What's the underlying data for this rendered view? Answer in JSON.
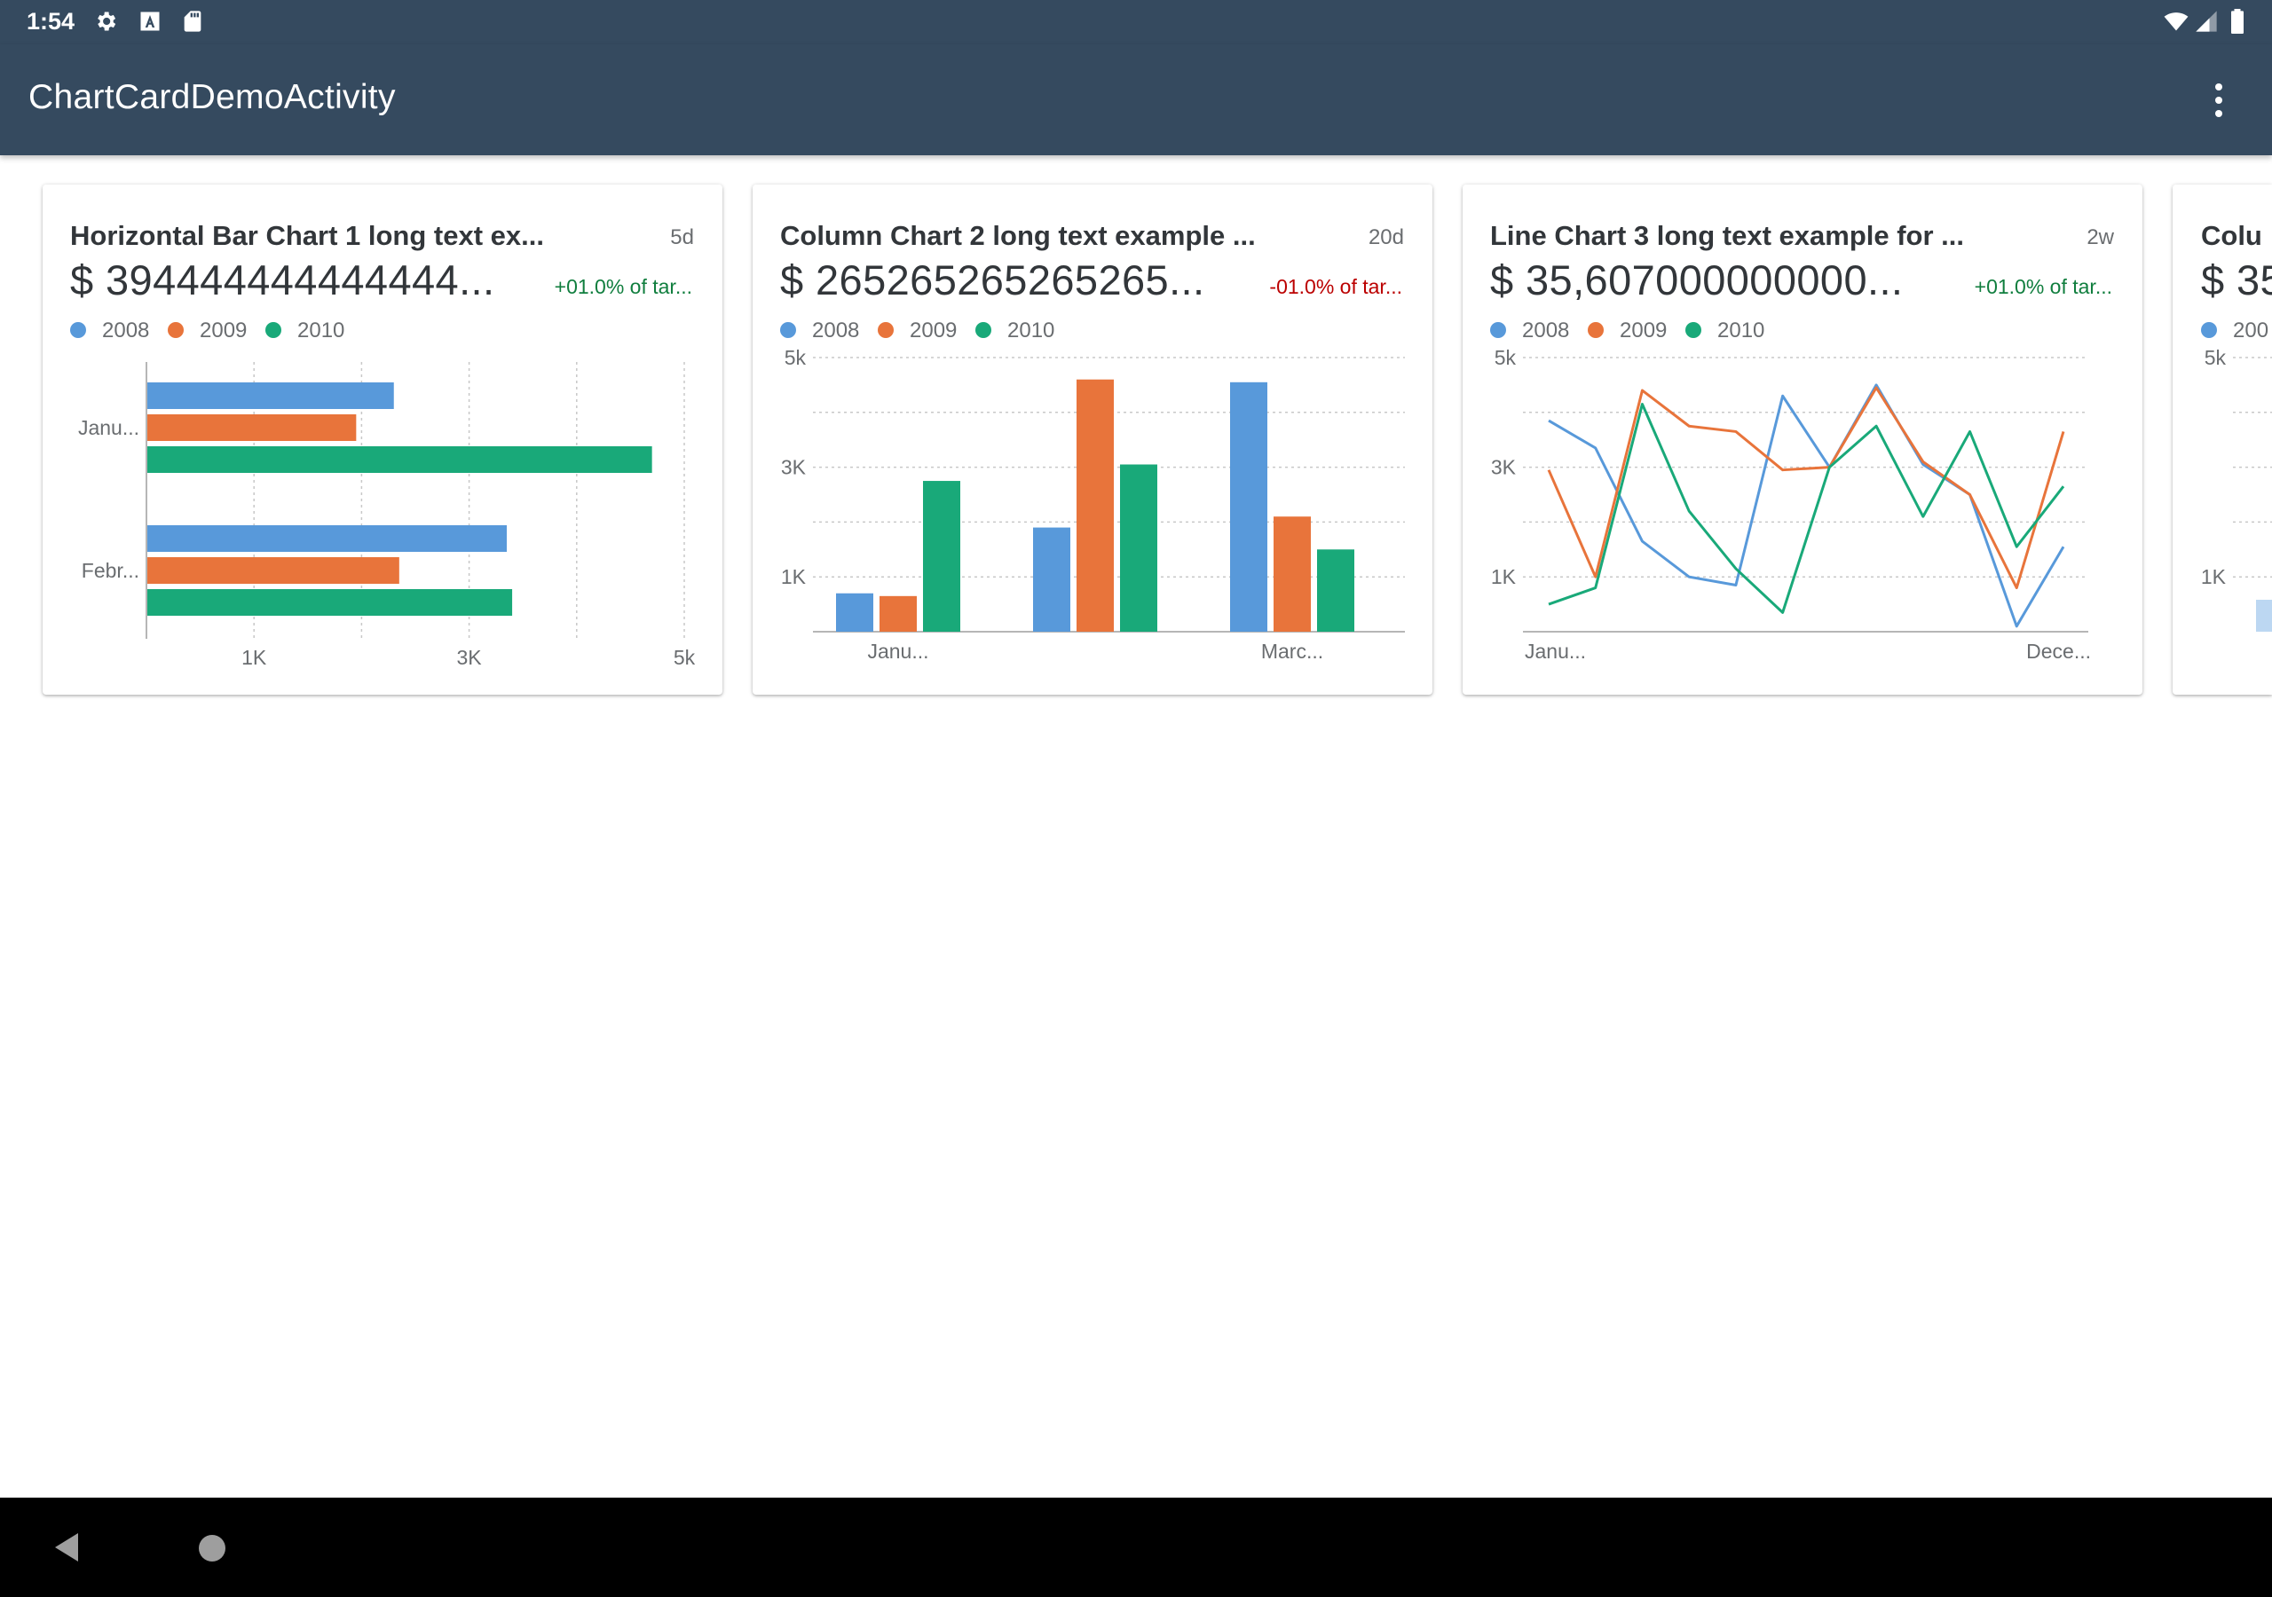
{
  "status_bar": {
    "time": "1:54",
    "icons": [
      "gear-icon",
      "text-a-icon",
      "sd-card-icon",
      "wifi-icon",
      "signal-icon",
      "battery-icon"
    ]
  },
  "app_bar": {
    "title": "ChartCardDemoActivity",
    "overflow_icon": "more-vert-icon"
  },
  "colors": {
    "bar": "#354a5f",
    "series_2008": "#5899da",
    "series_2009": "#e8743b",
    "series_2010": "#19a979",
    "positive": "#107e3e",
    "negative": "#bb0000"
  },
  "legend": [
    "2008",
    "2009",
    "2010"
  ],
  "cards": [
    {
      "title": "Horizontal Bar Chart 1 long text ex...",
      "age": "5d",
      "kpi": "$ 394444444444444...",
      "trend": "+01.0% of tar...",
      "trend_direction": "positive"
    },
    {
      "title": "Column Chart 2 long text example ...",
      "age": "20d",
      "kpi": "$ 265265265265265...",
      "trend": "-01.0% of tar...",
      "trend_direction": "negative"
    },
    {
      "title": "Line Chart 3 long text example for ...",
      "age": "2w",
      "kpi": "$ 35,607000000000...",
      "trend": "+01.0% of tar...",
      "trend_direction": "positive"
    },
    {
      "title": "Colu",
      "age": "",
      "kpi": "$ 35",
      "trend": "",
      "legend_partial": "200"
    }
  ],
  "chart_data": [
    {
      "type": "bar",
      "orientation": "horizontal",
      "categories": [
        "Janu...",
        "Febr..."
      ],
      "series": [
        {
          "name": "2008",
          "values": [
            2300,
            3350
          ]
        },
        {
          "name": "2009",
          "values": [
            1950,
            2350
          ]
        },
        {
          "name": "2010",
          "values": [
            4700,
            3400
          ]
        }
      ],
      "xlim": [
        0,
        5000
      ],
      "x_tick_labels": [
        "1K",
        "3K",
        "5k"
      ],
      "x_tick_values": [
        1000,
        3000,
        5000
      ],
      "grid": true
    },
    {
      "type": "bar",
      "categories": [
        "Janu...",
        "",
        "Marc..."
      ],
      "series": [
        {
          "name": "2008",
          "values": [
            700,
            1900,
            4550
          ]
        },
        {
          "name": "2009",
          "values": [
            650,
            4600,
            2100
          ]
        },
        {
          "name": "2010",
          "values": [
            2750,
            3050,
            1500
          ]
        }
      ],
      "ylim": [
        0,
        5000
      ],
      "y_tick_labels": [
        "1K",
        "3K",
        "5k"
      ],
      "y_tick_values": [
        1000,
        3000,
        5000
      ],
      "grid": true
    },
    {
      "type": "line",
      "categories": [
        "Janu...",
        "",
        "",
        "",
        "",
        "",
        "",
        "",
        "",
        "",
        "",
        "Dece..."
      ],
      "series": [
        {
          "name": "2008",
          "values": [
            3850,
            3350,
            1650,
            1000,
            850,
            4300,
            3000,
            4500,
            3050,
            2500,
            100,
            1550
          ]
        },
        {
          "name": "2009",
          "values": [
            2950,
            1000,
            4400,
            3750,
            3650,
            2950,
            3000,
            4450,
            3100,
            2500,
            800,
            3650
          ]
        },
        {
          "name": "2010",
          "values": [
            500,
            800,
            4150,
            2200,
            1150,
            350,
            3000,
            3750,
            2100,
            3650,
            1550,
            2650
          ]
        }
      ],
      "ylim": [
        0,
        5000
      ],
      "y_tick_labels": [
        "1K",
        "3K",
        "5k"
      ],
      "y_tick_values": [
        1000,
        3000,
        5000
      ],
      "grid": true
    },
    {
      "type": "bar",
      "partial": true,
      "ylim": [
        0,
        5000
      ],
      "y_tick_labels": [
        "1K",
        "5k"
      ],
      "y_tick_values": [
        1000,
        5000
      ]
    }
  ],
  "nav_bar": {
    "back_icon": "back-triangle-icon",
    "home_icon": "home-circle-icon"
  }
}
